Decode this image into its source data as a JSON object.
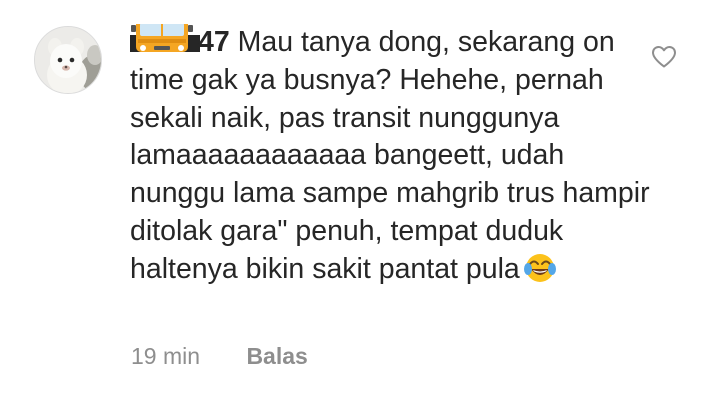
{
  "comment": {
    "username_emoji": "bus-emoji",
    "username_suffix": "47",
    "text": " Mau tanya dong, sekarang on time gak ya busnya? Hehehe, pernah sekali naik, pas transit nunggunya lamaaaaaaaaaaaa bangeett, udah nunggu lama sampe mahgrib trus hampir ditolak gara\" penuh, tempat duduk haltenya bikin sakit pantat pula",
    "trailing_emoji": "face-with-tears-of-joy-emoji",
    "time": "19 min",
    "reply_label": "Balas",
    "like_icon": "heart-outline-icon"
  },
  "colors": {
    "text": "#262626",
    "meta": "#8e8e8e",
    "bus_body": "#f5a623",
    "emoji_face": "#fcc21b"
  }
}
